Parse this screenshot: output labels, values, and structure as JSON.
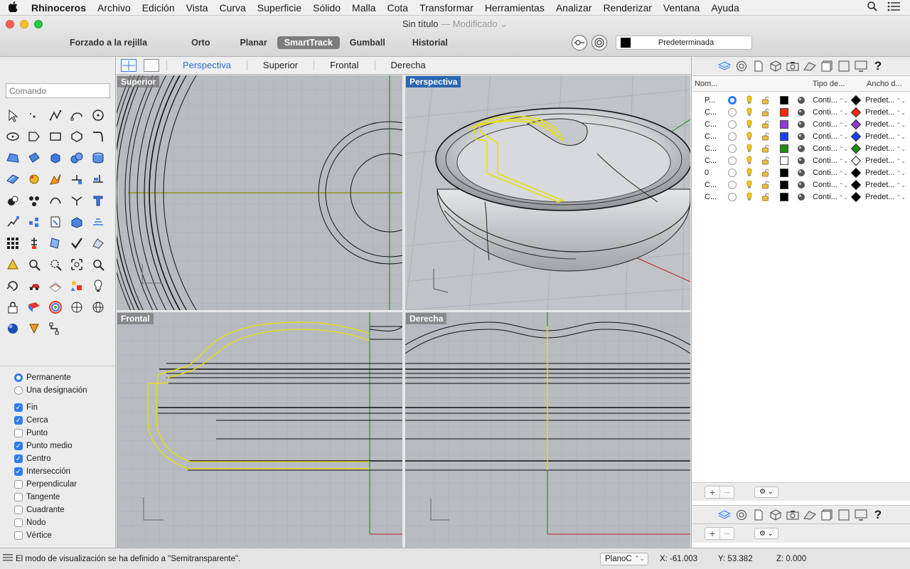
{
  "menubar": {
    "apple": "",
    "items": [
      "Rhinoceros",
      "Archivo",
      "Edición",
      "Vista",
      "Curva",
      "Superficie",
      "Sólido",
      "Malla",
      "Cota",
      "Transformar",
      "Herramientas",
      "Analizar",
      "Renderizar",
      "Ventana",
      "Ayuda"
    ]
  },
  "window": {
    "title": "Sin título",
    "modified": "— Modificado ⌄"
  },
  "modes": [
    "Forzado a la rejilla",
    "Orto",
    "Planar",
    "SmartTrack",
    "Gumball",
    "Historial"
  ],
  "active_mode": "SmartTrack",
  "layer_selector": {
    "label": "Predeterminada",
    "color": "#000000"
  },
  "command": {
    "placeholder": "Comando"
  },
  "snaps": {
    "radios": [
      {
        "label": "Permanente",
        "selected": true
      },
      {
        "label": "Una designación",
        "selected": false
      }
    ],
    "checks": [
      {
        "label": "Fin",
        "checked": true
      },
      {
        "label": "Cerca",
        "checked": true
      },
      {
        "label": "Punto",
        "checked": false
      },
      {
        "label": "Punto medio",
        "checked": true
      },
      {
        "label": "Centro",
        "checked": true
      },
      {
        "label": "Intersección",
        "checked": true
      },
      {
        "label": "Perpendicular",
        "checked": false
      },
      {
        "label": "Tangente",
        "checked": false
      },
      {
        "label": "Cuadrante",
        "checked": false
      },
      {
        "label": "Nodo",
        "checked": false
      },
      {
        "label": "Vértice",
        "checked": false
      }
    ]
  },
  "viewport_tabs": [
    "Perspectiva",
    "Superior",
    "Frontal",
    "Derecha"
  ],
  "active_tab": "Perspectiva",
  "viewports": {
    "top_left": "Superior",
    "top_right": "Perspectiva",
    "bottom_left": "Frontal",
    "bottom_right": "Derecha"
  },
  "layers": {
    "headers": {
      "name": "Nom...",
      "type": "Tipo de...",
      "width": "Ancho d..."
    },
    "rows": [
      {
        "name": "P...",
        "current": true,
        "color": "#000000",
        "linetype": "Conti...",
        "printcolor": "#000000",
        "printwidth": "Predet..."
      },
      {
        "name": "C...",
        "current": false,
        "color": "#ff2a00",
        "linetype": "Conti...",
        "printcolor": "#ff2a00",
        "printwidth": "Predet..."
      },
      {
        "name": "C...",
        "current": false,
        "color": "#8e3ccf",
        "linetype": "Conti...",
        "printcolor": "#8e3ccf",
        "printwidth": "Predet..."
      },
      {
        "name": "C...",
        "current": false,
        "color": "#1741ff",
        "linetype": "Conti...",
        "printcolor": "#1741ff",
        "printwidth": "Predet..."
      },
      {
        "name": "C...",
        "current": false,
        "color": "#1f8f12",
        "linetype": "Conti...",
        "printcolor": "#1f8f12",
        "printwidth": "Predet..."
      },
      {
        "name": "C...",
        "current": false,
        "color": "#ffffff",
        "linetype": "Conti...",
        "printcolor": "#ffffff",
        "printwidth": "Predet..."
      },
      {
        "name": "0",
        "current": false,
        "color": "#000000",
        "linetype": "Conti...",
        "printcolor": "#000000",
        "printwidth": "Predet..."
      },
      {
        "name": "C...",
        "current": false,
        "color": "#000000",
        "linetype": "Conti...",
        "printcolor": "#000000",
        "printwidth": "Predet..."
      },
      {
        "name": "C...",
        "current": false,
        "color": "#000000",
        "linetype": "Conti...",
        "printcolor": "#000000",
        "printwidth": "Predet..."
      }
    ]
  },
  "status": {
    "message": "El modo de visualización se ha definido a \"Semitransparente\".",
    "plane": "PlanoC",
    "x": "X: -61.003",
    "y": "Y: 53.382",
    "z": "Z: 0.000"
  },
  "colors": {
    "accent": "#2d7cf6",
    "active_viewport": "#2b66b3",
    "selection": "#e8e000",
    "viewport_bg": "#b8bcc1"
  }
}
